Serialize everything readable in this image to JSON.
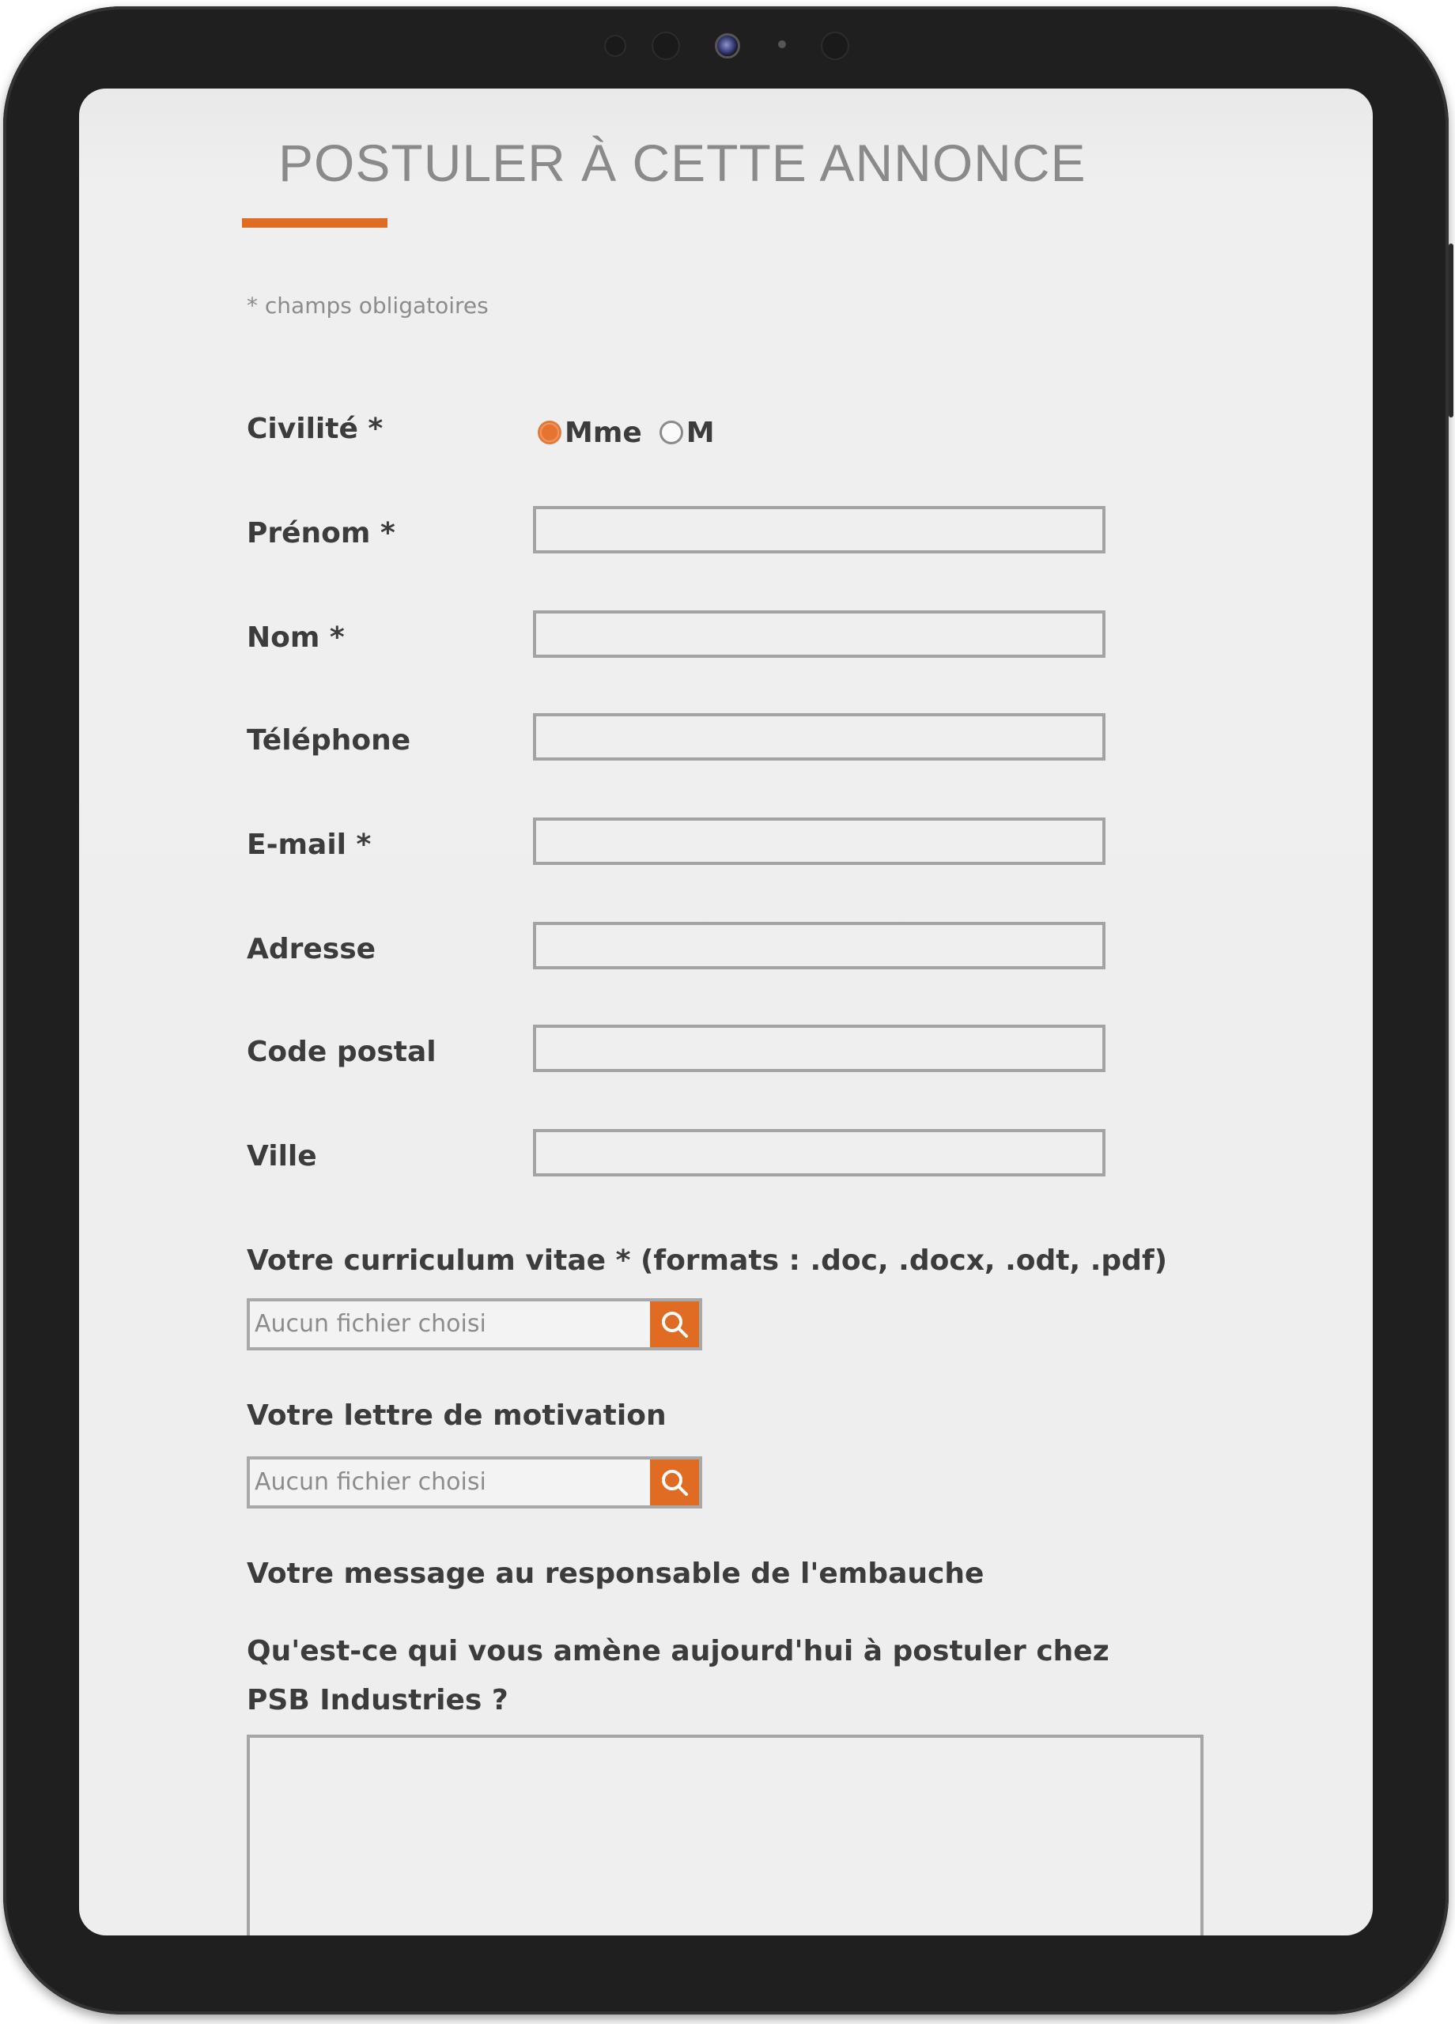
{
  "form": {
    "title": "POSTULER À CETTE ANNONCE",
    "required_note": "* champs obligatoires",
    "civility": {
      "label": "Civilité *",
      "options": [
        "Mme",
        "M"
      ],
      "selected": "Mme"
    },
    "first_name": {
      "label": "Prénom *",
      "value": ""
    },
    "last_name": {
      "label": "Nom *",
      "value": ""
    },
    "phone": {
      "label": "Téléphone",
      "value": ""
    },
    "email": {
      "label": "E-mail *",
      "value": ""
    },
    "address": {
      "label": "Adresse",
      "value": ""
    },
    "postal_code": {
      "label": "Code postal",
      "value": ""
    },
    "city": {
      "label": "Ville",
      "value": ""
    },
    "cv": {
      "label": "Votre curriculum vitae * (formats : .doc, .docx, .odt, .pdf)",
      "file_status": "Aucun fichier choisi"
    },
    "cover_letter": {
      "label": "Votre lettre de motivation",
      "file_status": "Aucun fichier choisi"
    },
    "message": {
      "label": "Votre message au responsable de l'embauche",
      "question": "Qu'est-ce qui vous amène aujourd'hui à postuler chez PSB Industries ?",
      "value": ""
    }
  },
  "colors": {
    "accent": "#e06b22",
    "device_frame": "#1f1f1f",
    "screen_background": "#eeeeee"
  },
  "icons": {
    "browse": "search-icon"
  }
}
